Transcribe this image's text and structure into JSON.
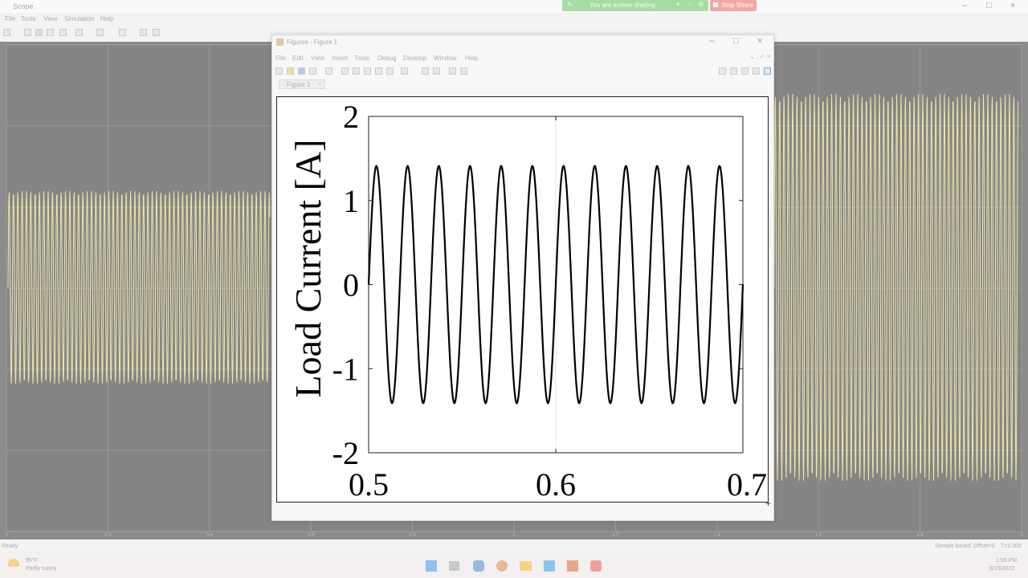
{
  "scope": {
    "title": "Scope",
    "menu": [
      "File",
      "Tools",
      "View",
      "Simulation",
      "Help"
    ],
    "x_ticks": [
      "0",
      "0.2",
      "0.4",
      "0.6",
      "0.8",
      "1",
      "1.2",
      "1.4",
      "1.6",
      "1.8",
      "2"
    ],
    "status_ready": "Ready",
    "status_right": [
      "Sample based",
      "Offset=0",
      "T=2.000"
    ]
  },
  "share": {
    "text": "You are screen sharing",
    "stop_label": "Stop Share"
  },
  "figure": {
    "window_title": "Figures - Figure 1",
    "menu": [
      "File",
      "Edit",
      "View",
      "Insert",
      "Tools",
      "Debug",
      "Desktop",
      "Window",
      "Help"
    ],
    "tab_label": "Figure 1"
  },
  "taskbar": {
    "weather_temp": "95°F",
    "weather_desc": "Partly sunny",
    "time": "1:55 PM",
    "date": "8/15/2022"
  },
  "chart_data": {
    "type": "line",
    "ylabel": "Load Current [A]",
    "xlabel": "",
    "xlim": [
      0.5,
      0.7
    ],
    "ylim": [
      -2,
      2
    ],
    "x_ticks": [
      "0.5",
      "0.6",
      "0.7"
    ],
    "y_ticks": [
      "2",
      "1",
      "0",
      "-1",
      "-2"
    ],
    "grid": false,
    "series": [
      {
        "amplitude": 1.41,
        "frequency_hz": 60,
        "start_x": 0.5,
        "end_x": 0.7,
        "color": "#000000"
      }
    ]
  },
  "colors": {
    "scope_bg": "#8b8b8b",
    "scope_trace": "#f0e8a8",
    "share_green": "#a7dca4",
    "stop_red": "#f5a5a5"
  }
}
